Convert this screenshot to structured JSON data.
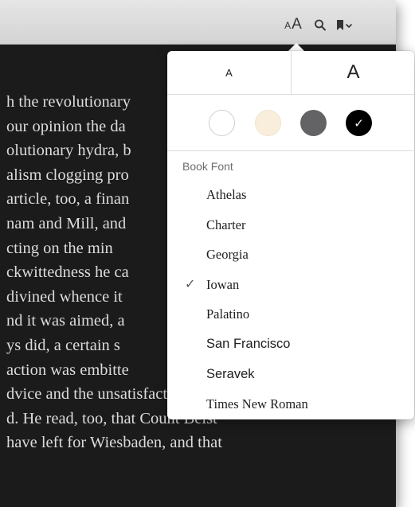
{
  "toolbar": {
    "font_size_small_glyph": "A",
    "font_size_big_glyph": "A",
    "icons": [
      "font-size-icon",
      "search-icon",
      "bookmark-icon",
      "chevron-down-icon"
    ]
  },
  "book": {
    "lines": [
      "h the revolutionary",
      "our opinion the da",
      "olutionary hydra, b",
      "alism clogging pro",
      "article, too, a finan",
      "nam and Mill, and",
      "cting on the min",
      "ckwittedness he ca",
      "divined whence it",
      "nd it was aimed, a",
      "ys did, a certain s",
      "action was embitte",
      "dvice and the unsatisfactory state",
      "d. He read, too, that Count Beist",
      "have left for Wiesbaden, and that"
    ]
  },
  "popover": {
    "smaller_label": "A",
    "larger_label": "A",
    "themes": [
      {
        "name": "white",
        "color": "#ffffff",
        "selected": false
      },
      {
        "name": "sepia",
        "color": "#f8eedb",
        "selected": false
      },
      {
        "name": "gray",
        "color": "#636366",
        "selected": false
      },
      {
        "name": "night",
        "color": "#000000",
        "selected": true
      }
    ],
    "theme_check": "✓",
    "font_section_label": "Book Font",
    "fonts": [
      {
        "label": "Athelas",
        "selected": false
      },
      {
        "label": "Charter",
        "selected": false
      },
      {
        "label": "Georgia",
        "selected": false
      },
      {
        "label": "Iowan",
        "selected": true
      },
      {
        "label": "Palatino",
        "selected": false
      },
      {
        "label": "San Francisco",
        "selected": false
      },
      {
        "label": "Seravek",
        "selected": false
      },
      {
        "label": "Times New Roman",
        "selected": false
      }
    ],
    "font_check": "✓"
  }
}
